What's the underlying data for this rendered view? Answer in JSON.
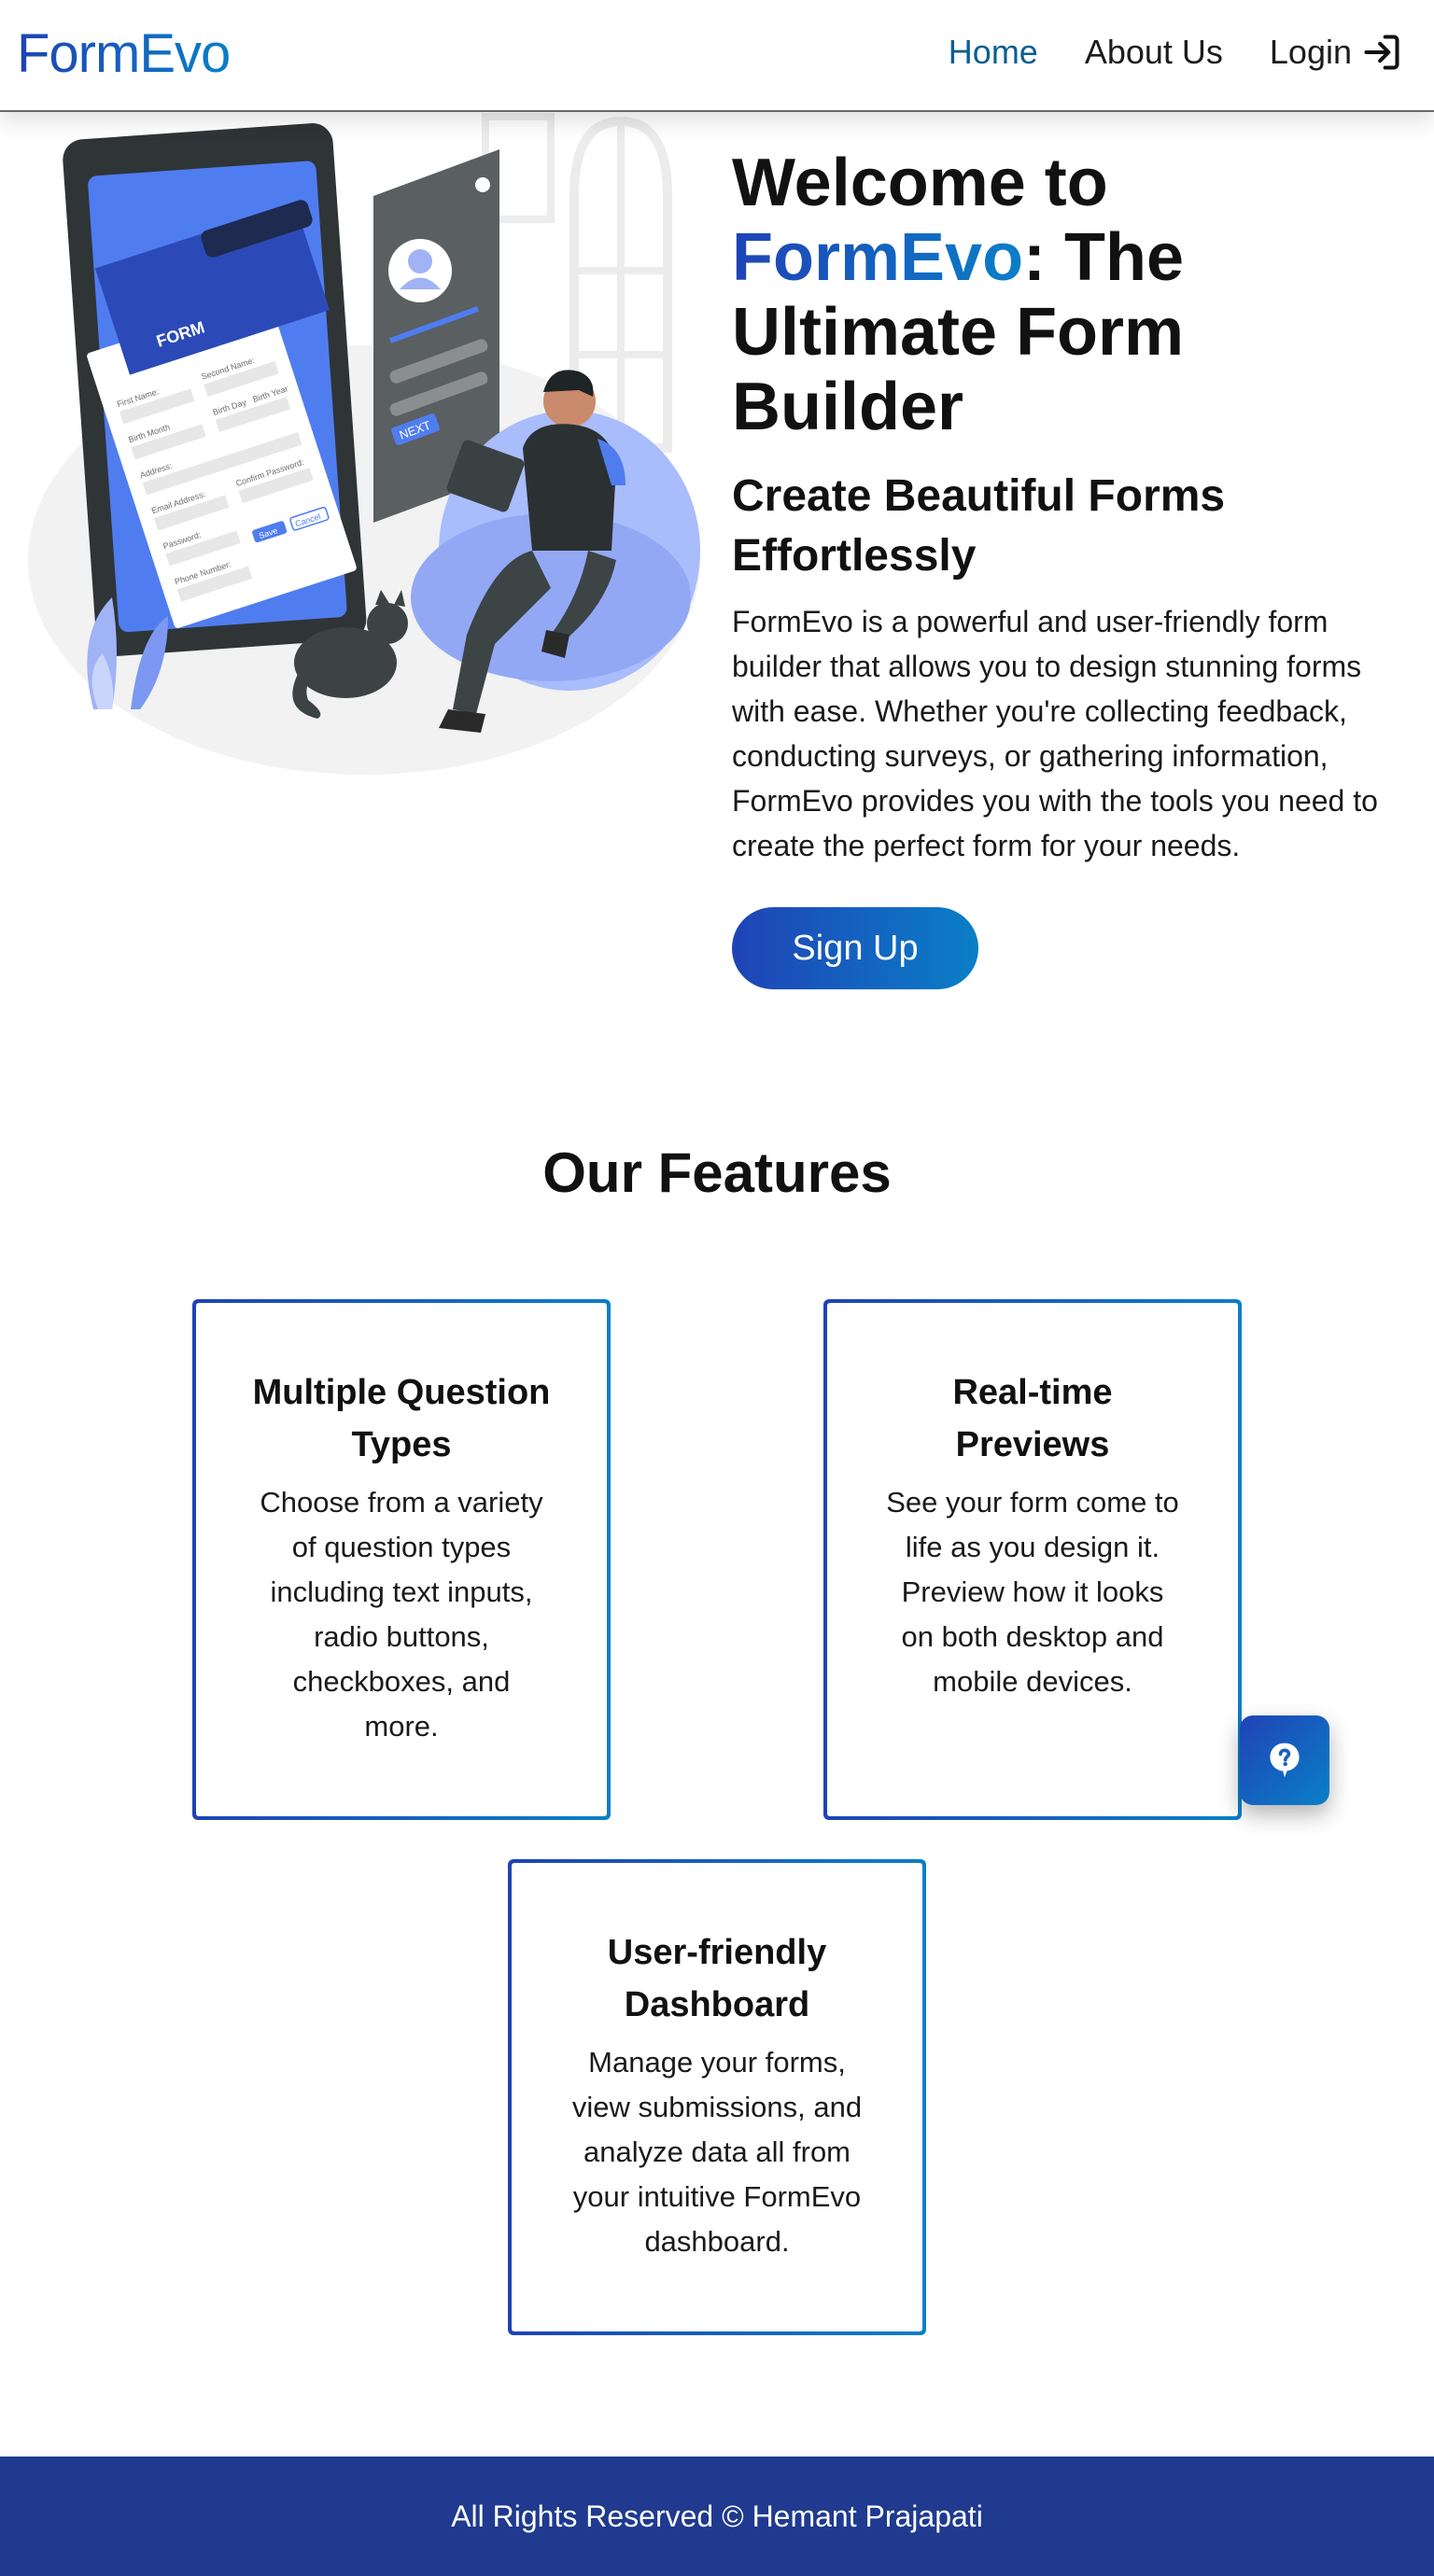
{
  "header": {
    "logo": "FormEvo",
    "nav": {
      "home": "Home",
      "about": "About Us",
      "login": "Login"
    }
  },
  "hero": {
    "title_prefix": "Welcome to ",
    "title_brand": "FormEvo",
    "title_suffix": ": The Ultimate Form Builder",
    "subtitle": "Create Beautiful Forms Effortlessly",
    "description": "FormEvo is a powerful and user-friendly form builder that allows you to design stunning forms with ease. Whether you're collecting feedback, conducting surveys, or gathering information, FormEvo provides you with the tools you need to create the perfect form for your needs.",
    "signup_label": "Sign Up",
    "illustration": {
      "form_label": "FORM",
      "fields": [
        "First Name:",
        "Second Name:",
        "Birth Month",
        "Birth Day",
        "Birth Year",
        "Address:",
        "Email Address:",
        "Confirm Password:",
        "Password:",
        "Phone Number:"
      ],
      "save_label": "Save",
      "cancel_label": "Cancel",
      "next_label": "NEXT"
    }
  },
  "features": {
    "heading": "Our Features",
    "items": [
      {
        "title": "Multiple Question Types",
        "description": "Choose from a variety of question types including text inputs, radio buttons, checkboxes, and more."
      },
      {
        "title": "Real-time Previews",
        "description": "See your form come to life as you design it. Preview how it looks on both desktop and mobile devices."
      },
      {
        "title": "User-friendly Dashboard",
        "description": "Manage your forms, view submissions, and analyze data all from your intuitive FormEvo dashboard."
      }
    ]
  },
  "help_icon": "help-icon",
  "login_icon": "login-arrow-icon",
  "footer": {
    "text": "All Rights Reserved © Hemant Prajapati"
  },
  "colors": {
    "brand_start": "#1f43b6",
    "brand_end": "#0a7fc7",
    "footer_bg": "#1f3a8f",
    "nav_active": "#0b5f8f"
  }
}
